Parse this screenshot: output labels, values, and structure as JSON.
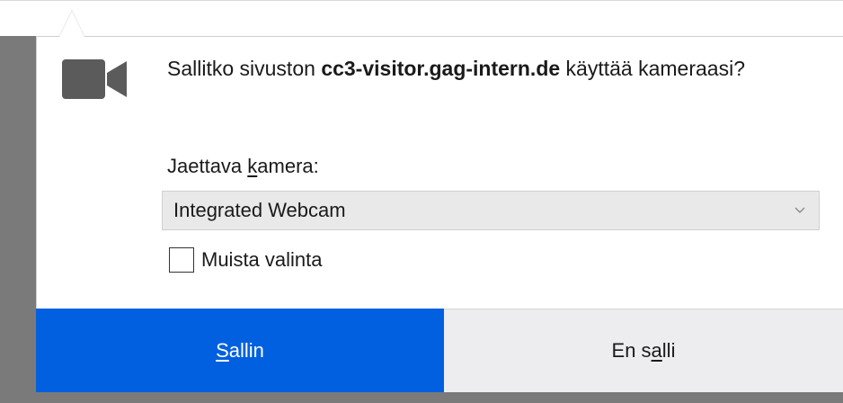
{
  "prompt": {
    "message_prefix": "Sallitko sivuston ",
    "site": "cc3-visitor.gag-intern.de",
    "message_suffix": " käyttää kameraasi?",
    "camera_label_prefix": "Jaettava ",
    "camera_label_accesskey": "k",
    "camera_label_rest": "amera:",
    "selected_camera": "Integrated Webcam",
    "remember_label": "Muista valinta",
    "remember_checked": false
  },
  "buttons": {
    "allow_accesskey": "S",
    "allow_rest": "allin",
    "deny_prefix": "En s",
    "deny_accesskey": "a",
    "deny_rest": "lli"
  },
  "icons": {
    "camera": "video-camera-icon",
    "dropdown": "chevron-down-icon"
  },
  "colors": {
    "allow_bg": "#0060df",
    "deny_bg": "#ededf0",
    "icon": "#5b5b5b"
  }
}
